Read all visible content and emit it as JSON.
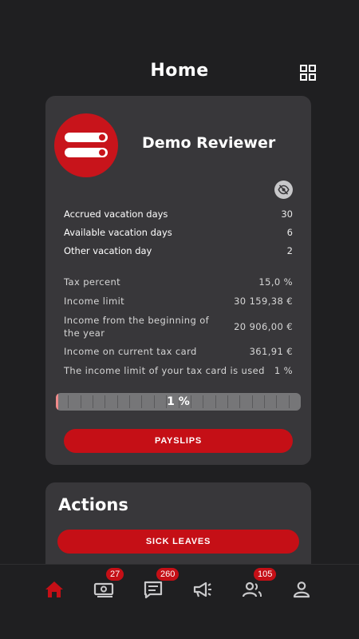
{
  "header": {
    "title": "Home",
    "menu_icon": "grid-icon"
  },
  "profile": {
    "name": "Demo Reviewer",
    "avatar_icon": "toggle-bars-logo",
    "visibility_icon": "eye-off-icon",
    "vacation": [
      {
        "label": "Accrued vacation days",
        "value": "30"
      },
      {
        "label": "Available vacation days",
        "value": "6"
      },
      {
        "label": "Other vacation day",
        "value": "2"
      }
    ],
    "tax": [
      {
        "label": "Tax percent",
        "value": "15,0 %"
      },
      {
        "label": "Income limit",
        "value": "30 159,38 €"
      },
      {
        "label": "Income from the beginning of the year",
        "value": "20 906,00 €"
      },
      {
        "label": "Income on current tax card",
        "value": "361,91 €"
      },
      {
        "label": "The income limit of your tax card is used",
        "value": "1 %"
      }
    ],
    "progress": {
      "label": "1 %",
      "fraction": 0.01
    },
    "payslips_label": "PAYSLIPS"
  },
  "actions": {
    "title": "Actions",
    "sick_leaves_label": "SICK LEAVES"
  },
  "tabs": [
    {
      "name": "home",
      "icon": "home-icon",
      "active": true
    },
    {
      "name": "payments",
      "icon": "money-icon",
      "badge": "27"
    },
    {
      "name": "messages",
      "icon": "chat-icon",
      "badge": "260"
    },
    {
      "name": "announcements",
      "icon": "megaphone-icon"
    },
    {
      "name": "colleagues",
      "icon": "people-icon",
      "badge": "105"
    },
    {
      "name": "profile",
      "icon": "person-icon"
    }
  ],
  "colors": {
    "accent": "#c50f16",
    "background": "#1f1f21",
    "card": "#38373a",
    "progress_fill": "#f08a8a"
  }
}
